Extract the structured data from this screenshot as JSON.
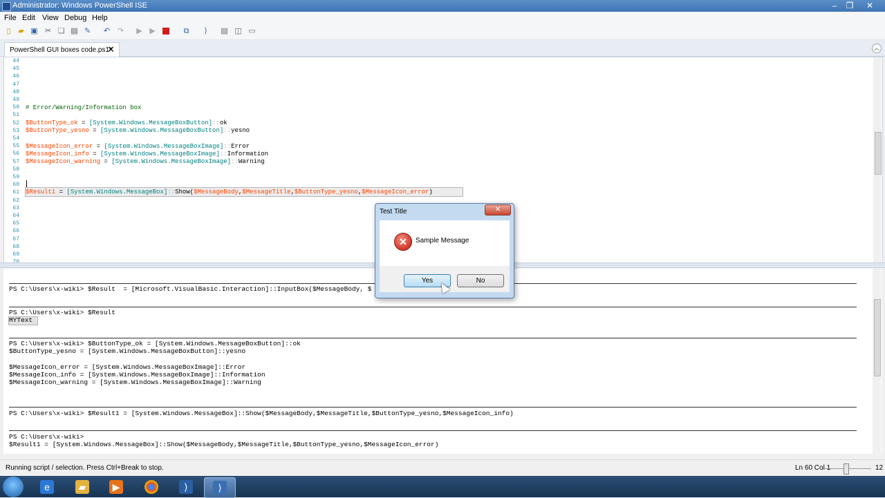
{
  "window": {
    "title": "Administrator: Windows PowerShell ISE"
  },
  "menu": {
    "items": [
      "File",
      "Edit",
      "View",
      "Debug",
      "Help"
    ]
  },
  "toolbar": {
    "icons": [
      "new-icon",
      "open-icon",
      "save-icon",
      "cut-icon",
      "copy-icon",
      "paste-icon",
      "clear-icon",
      "undo-icon",
      "redo-icon",
      "run-icon",
      "run-selection-icon",
      "stop-icon",
      "remote-icon",
      "console-icon",
      "pane-top-icon",
      "pane-right-icon",
      "pane-max-icon"
    ]
  },
  "tab": {
    "label": "PowerShell GUI boxes code.ps1*",
    "close_glyph": "✕"
  },
  "script": {
    "line_numbers": [
      "44",
      "45",
      "46",
      "47",
      "48",
      "49",
      "50",
      "51",
      "52",
      "53",
      "54",
      "55",
      "56",
      "57",
      "58",
      "59",
      "60",
      "61",
      "62",
      "63",
      "64",
      "65",
      "66",
      "67",
      "68",
      "69",
      "70"
    ],
    "lines": {
      "l50": "# Error/Warning/Information box",
      "l52_var": "$ButtonType_ok",
      "l52_eq": " = ",
      "l52_type": "[System.Windows.MessageBoxButton]",
      "l52_sep": "::",
      "l52_val": "ok",
      "l53_var": "$ButtonType_yesno",
      "l53_eq": " = ",
      "l53_type": "[System.Windows.MessageBoxButton]",
      "l53_sep": "::",
      "l53_val": "yesno",
      "l55_var": "$MessageIcon_error",
      "l55_eq": " = ",
      "l55_type": "[System.Windows.MessageBoxImage]",
      "l55_sep": "::",
      "l55_val": "Error",
      "l56_var": "$MessageIcon_info",
      "l56_eq": " = ",
      "l56_type": "[System.Windows.MessageBoxImage]",
      "l56_sep": "::",
      "l56_val": "Information",
      "l57_var": "$MessageIcon_warning",
      "l57_eq": " = ",
      "l57_type": "[System.Windows.MessageBoxImage]",
      "l57_sep": "::",
      "l57_val": "Warning",
      "l61_var": "$Result1",
      "l61_eq": " = ",
      "l61_type": "[System.Windows.MessageBox]",
      "l61_sep": "::",
      "l61_call": "Show(",
      "l61_a1": "$MessageBody",
      "l61_c": ",",
      "l61_a2": "$MessageTitle",
      "l61_a3": "$ButtonType_yesno",
      "l61_a4": "$MessageIcon_error",
      "l61_end": ")"
    }
  },
  "console": {
    "lines": {
      "c1": "PS C:\\Users\\x-wiki> $Result  = [Microsoft.VisualBasic.Interaction]::InputBox($MessageBody, $",
      "c2": "PS C:\\Users\\x-wiki> $Result",
      "c3": "MYText",
      "c4": "PS C:\\Users\\x-wiki> $ButtonType_ok = [System.Windows.MessageBoxButton]::ok",
      "c5": "$ButtonType_yesno = [System.Windows.MessageBoxButton]::yesno",
      "c6": "$MessageIcon_error = [System.Windows.MessageBoxImage]::Error",
      "c7": "$MessageIcon_info = [System.Windows.MessageBoxImage]::Information",
      "c8": "$MessageIcon_warning = [System.Windows.MessageBoxImage]::Warning",
      "c9": "PS C:\\Users\\x-wiki> $Result1 = [System.Windows.MessageBox]::Show($MessageBody,$MessageTitle,$ButtonType_yesno,$MessageIcon_info)",
      "c10": "PS C:\\Users\\x-wiki>",
      "c11": "$Result1 = [System.Windows.MessageBox]::Show($MessageBody,$MessageTitle,$ButtonType_yesno,$MessageIcon_error)"
    }
  },
  "status": {
    "text": "Running script / selection.  Press Ctrl+Break to stop.",
    "position": "Ln 60  Col 1",
    "zoom": "12"
  },
  "dialog": {
    "title": "Test Title",
    "message": "Sample Message",
    "yes_label": "Yes",
    "no_label": "No",
    "close_glyph": "✕",
    "error_glyph": "✕"
  },
  "taskbar": {
    "apps": [
      "windows-start-icon",
      "internet-explorer-icon",
      "file-explorer-icon",
      "media-player-icon",
      "chrome-icon",
      "powershell-icon",
      "powershell-ise-icon"
    ]
  },
  "colors": {
    "variable": "#ff4500",
    "type": "#008080",
    "comment": "#006400",
    "line_number": "#2b91af",
    "title_bar": "#3f74b4"
  }
}
